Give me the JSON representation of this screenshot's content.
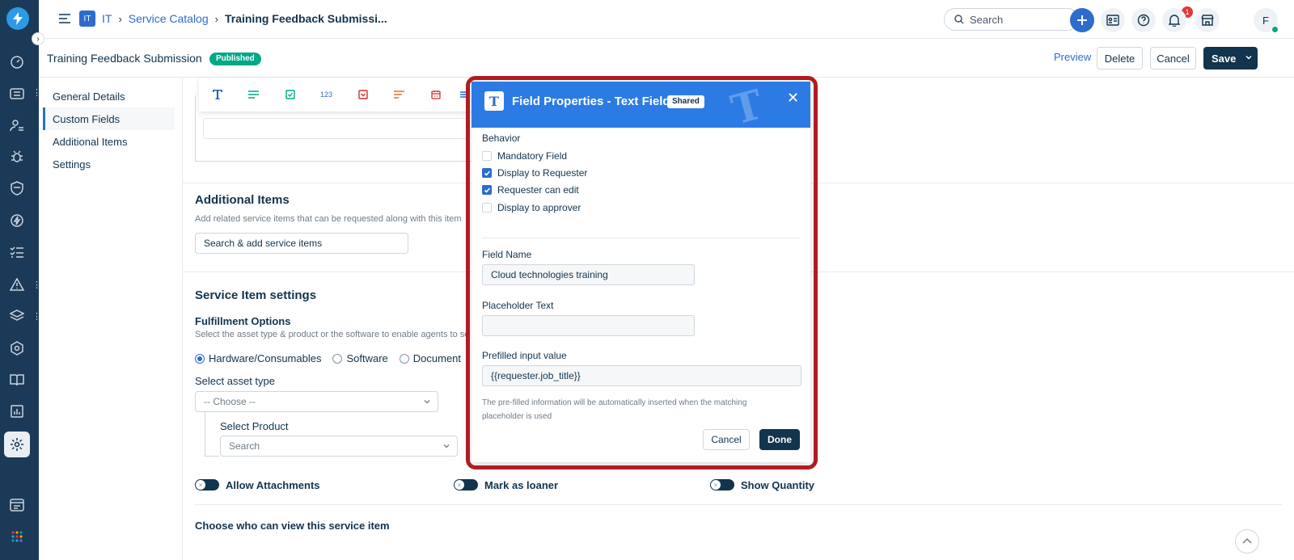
{
  "header": {
    "breadcrumb": {
      "module_badge": "IT",
      "module": "IT",
      "catalog": "Service Catalog",
      "current": "Training Feedback Submissi..."
    },
    "search_placeholder": "Search",
    "notification_count": "1",
    "avatar_initial": "F"
  },
  "subheader": {
    "title": "Training Feedback Submission",
    "status": "Published",
    "preview": "Preview",
    "delete": "Delete",
    "cancel": "Cancel",
    "save": "Save"
  },
  "sidenav": {
    "items": [
      {
        "label": "General Details"
      },
      {
        "label": "Custom Fields"
      },
      {
        "label": "Additional Items"
      },
      {
        "label": "Settings"
      }
    ]
  },
  "toolbar": {
    "number_icon_text": "123"
  },
  "additional_items": {
    "title": "Additional Items",
    "subtitle": "Add related service items that can be requested along with this item",
    "search_placeholder": "Search & add service items"
  },
  "service_item_settings": {
    "title": "Service Item settings",
    "fulfillment_title": "Fulfillment Options",
    "fulfillment_sub": "Select the asset type & product or the software to enable agents to sea",
    "radios": [
      {
        "label": "Hardware/Consumables",
        "selected": true
      },
      {
        "label": "Software",
        "selected": false
      },
      {
        "label": "Document",
        "selected": false
      }
    ],
    "asset_type_label": "Select asset type",
    "asset_type_value": "-- Choose --",
    "product_label": "Select Product",
    "product_placeholder": "Search",
    "toggles": [
      {
        "label": "Allow Attachments"
      },
      {
        "label": "Mark as loaner"
      },
      {
        "label": "Show Quantity"
      }
    ],
    "visibility_title": "Choose who can view this service item"
  },
  "modal": {
    "icon_letter": "T",
    "title": "Field Properties - Text Field",
    "shared": "Shared",
    "behavior_label": "Behavior",
    "checkboxes": [
      {
        "label": "Mandatory Field",
        "checked": false
      },
      {
        "label": "Display to Requester",
        "checked": true
      },
      {
        "label": "Requester can edit",
        "checked": true
      },
      {
        "label": "Display to approver",
        "checked": false
      }
    ],
    "field_name_label": "Field Name",
    "field_name_value": "Cloud technologies training",
    "placeholder_label": "Placeholder Text",
    "placeholder_value": "",
    "prefilled_label": "Prefilled input value",
    "prefilled_value": "{{requester.job_title}}",
    "hint": "The pre-filled information will be automatically inserted when the matching placeholder is used",
    "cancel": "Cancel",
    "done": "Done"
  },
  "colors": {
    "rail": "#1b3a57",
    "accent": "#2c6ccd",
    "modal_header": "#2c7be5",
    "published": "#00a886",
    "highlight": "#b01c23",
    "primary_button": "#12344d"
  }
}
